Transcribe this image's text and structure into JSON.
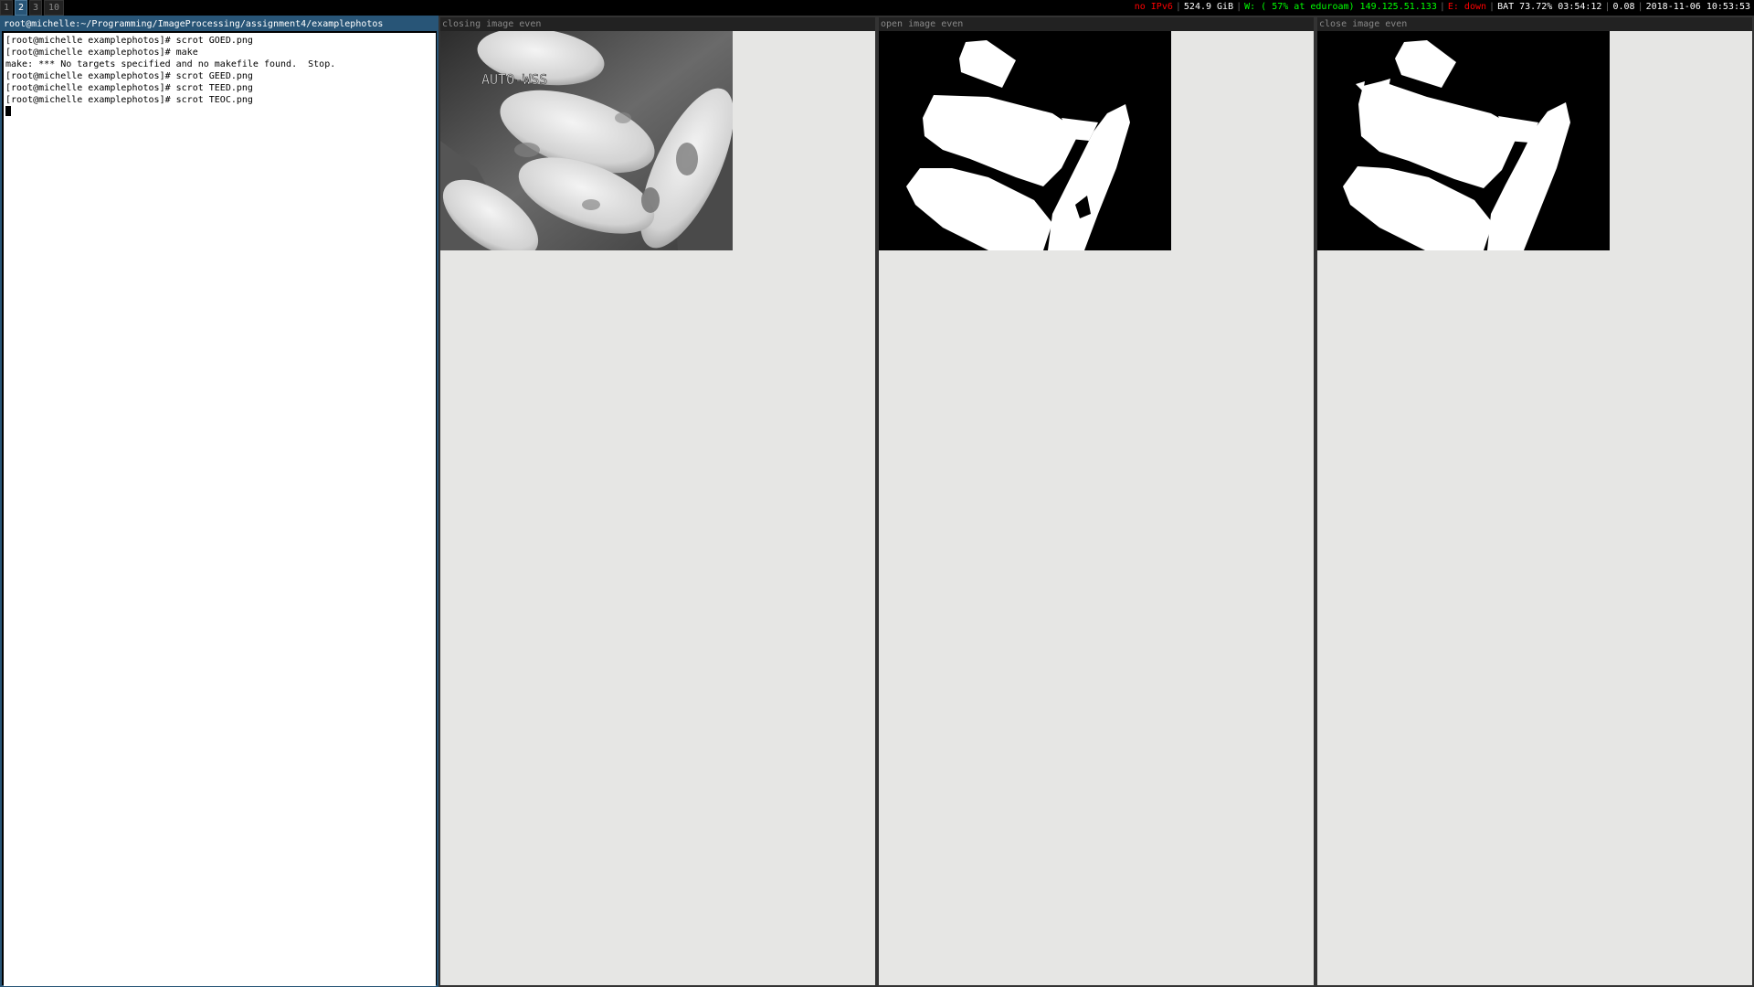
{
  "workspaces": [
    "1",
    "2",
    "3",
    "10"
  ],
  "active_workspace": "2",
  "status": {
    "ipv6": "no IPv6",
    "disk": "524.9 GiB",
    "wifi": "W: ( 57% at eduroam) 149.125.51.133",
    "eth": "E: down",
    "battery": "BAT 73.72% 03:54:12",
    "load": "0.08",
    "datetime": "2018-11-06 10:53:53"
  },
  "colors": {
    "focused": "#285577",
    "ok": "#00ff00",
    "bad": "#ff0000",
    "unfocused_bg": "#222222",
    "window_bg": "#e6e6e4"
  },
  "windows": {
    "terminal": {
      "title": "root@michelle:~/Programming/ImageProcessing/assignment4/examplephotos",
      "lines": [
        "[root@michelle examplephotos]# scrot GOED.png",
        "[root@michelle examplephotos]# make",
        "make: *** No targets specified and no makefile found.  Stop.",
        "[root@michelle examplephotos]# scrot GEED.png",
        "[root@michelle examplephotos]# scrot TEED.png",
        "[root@michelle examplephotos]# scrot TEOC.png"
      ]
    },
    "closing": {
      "title": "closing image even",
      "overlay_text": "AUTO-WSS"
    },
    "open": {
      "title": "open image even"
    },
    "close": {
      "title": "close image even"
    }
  }
}
